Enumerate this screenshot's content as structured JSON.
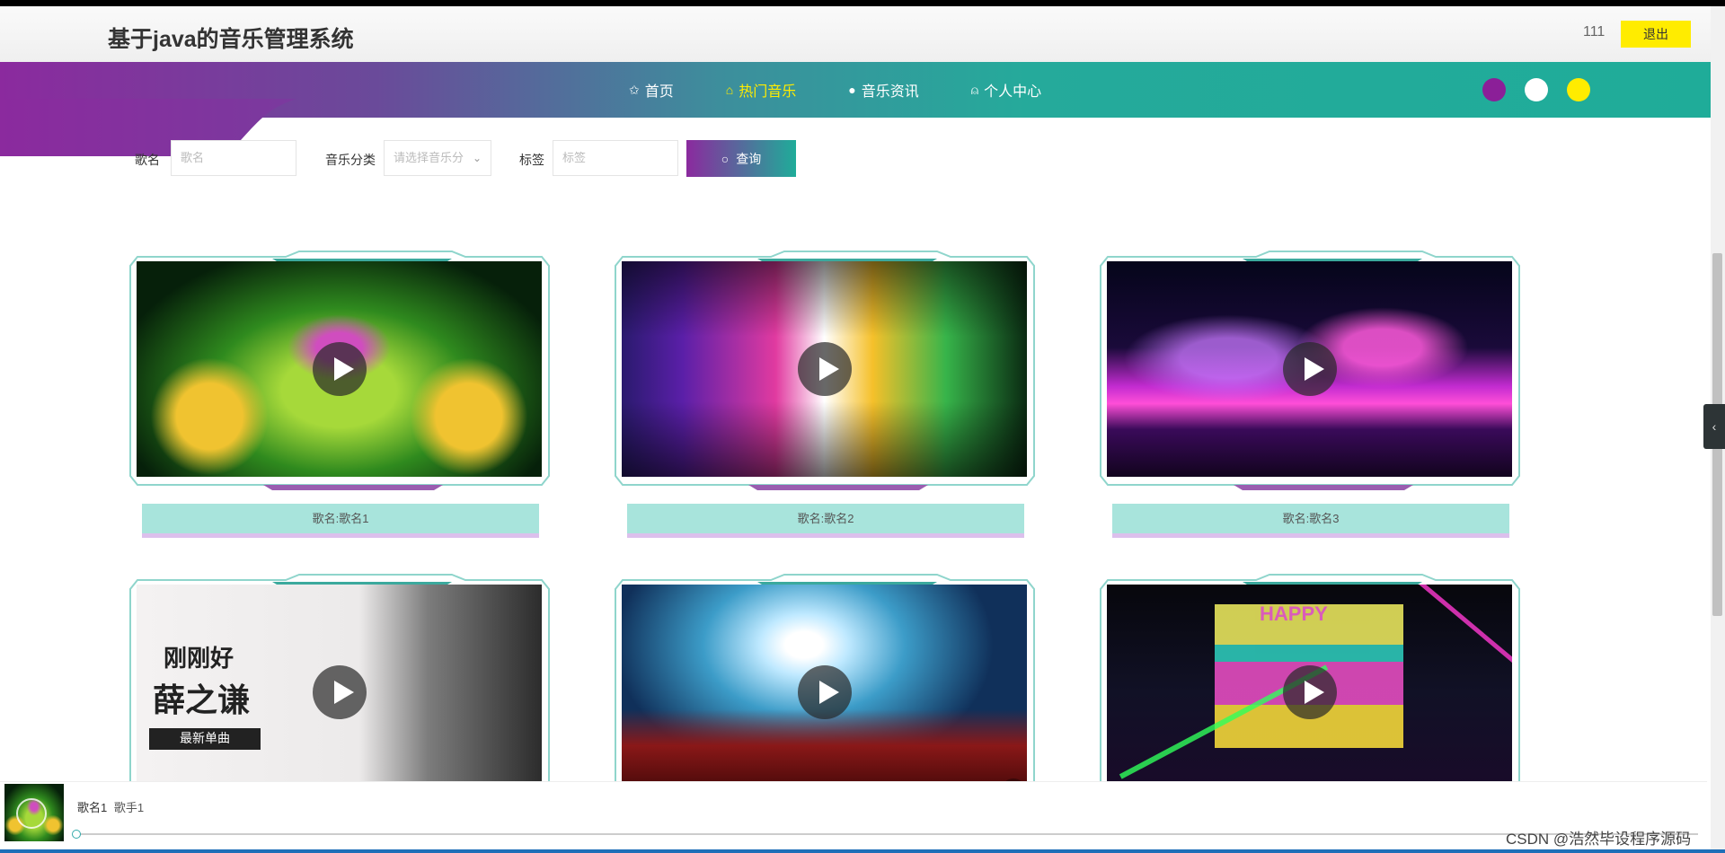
{
  "header": {
    "site_title": "基于java的音乐管理系统",
    "username": "111",
    "logout_label": "退出"
  },
  "nav": {
    "items": [
      {
        "label": "首页",
        "icon": "star-icon",
        "glyph": "✩",
        "active": false
      },
      {
        "label": "热门音乐",
        "icon": "bag-icon",
        "glyph": "⌂",
        "active": true
      },
      {
        "label": "音乐资讯",
        "icon": "info-icon",
        "glyph": "●",
        "active": false
      },
      {
        "label": "个人中心",
        "icon": "user-icon",
        "glyph": "⍝",
        "active": false
      }
    ],
    "theme_colors": [
      "#8b1f98",
      "#ffffff",
      "#ffec00"
    ]
  },
  "search": {
    "name_label": "歌名",
    "name_placeholder": "歌名",
    "category_label": "音乐分类",
    "category_placeholder": "请选择音乐分",
    "tag_label": "标签",
    "tag_placeholder": "标签",
    "button_label": "查询"
  },
  "songs": [
    {
      "caption": "歌名:歌名1"
    },
    {
      "caption": "歌名:歌名2"
    },
    {
      "caption": "歌名:歌名3"
    },
    {
      "caption": ""
    },
    {
      "caption": ""
    },
    {
      "caption": ""
    }
  ],
  "cover_text": {
    "line1": "刚刚好",
    "line2": "薛之谦",
    "tag": "最新单曲",
    "stage_word": "HAPPY"
  },
  "player": {
    "song": "歌名1",
    "artist": "歌手1",
    "progress": 0
  },
  "watermark": "CSDN @浩然毕设程序源码",
  "colors": {
    "accent_purple": "#8b2a9e",
    "accent_teal": "#1fac99",
    "accent_yellow": "#ffec00",
    "caption_bg": "#a8e4dc"
  }
}
